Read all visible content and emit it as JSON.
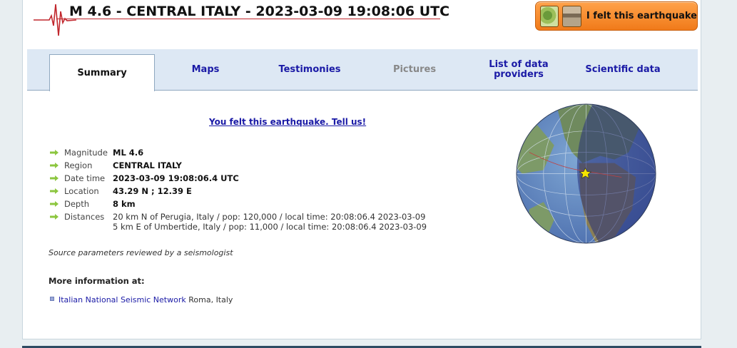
{
  "header": {
    "title": "M 4.6 - CENTRAL ITALY - 2023-03-09 19:08:06 UTC",
    "felt_button_label": "I felt this earthquake"
  },
  "tabs": [
    {
      "label": "Summary",
      "state": "active"
    },
    {
      "label": "Maps",
      "state": "normal"
    },
    {
      "label": "Testimonies",
      "state": "normal"
    },
    {
      "label": "Pictures",
      "state": "disabled"
    },
    {
      "label": "List of data providers",
      "state": "normal"
    },
    {
      "label": "Scientific data",
      "state": "normal"
    }
  ],
  "summary": {
    "tell_us_link": "You felt this earthquake. Tell us!",
    "params": [
      {
        "label": "Magnitude",
        "value": "ML 4.6"
      },
      {
        "label": "Region",
        "value": "CENTRAL ITALY"
      },
      {
        "label": "Date time",
        "value": "2023-03-09 19:08:06.4 UTC"
      },
      {
        "label": "Location",
        "value": "43.29 N ; 12.39 E"
      },
      {
        "label": "Depth",
        "value": "8 km"
      },
      {
        "label": "Distances",
        "value": "20 km N of Perugia, Italy / pop: 120,000 / local time: 20:08:06.4 2023-03-09",
        "value2": "5 km E of Umbertide, Italy / pop: 11,000 / local time: 20:08:06.4 2023-03-09"
      }
    ],
    "reviewed_note": "Source parameters reviewed by a seismologist",
    "more_info_heading": "More information at:",
    "network_link": "Italian National Seismic Network",
    "network_city": "Roma, Italy"
  },
  "colors": {
    "tab_link": "#1a1aa6",
    "felt_button": "#f58a2a",
    "title_rule": "#c1272d",
    "night_side": "#3a4aa0"
  },
  "icons": [
    "seismogram-logo-icon",
    "felt-map-icon",
    "felt-house-icon",
    "green-arrow-icon",
    "list-bullet-icon",
    "epicenter-star-icon"
  ]
}
